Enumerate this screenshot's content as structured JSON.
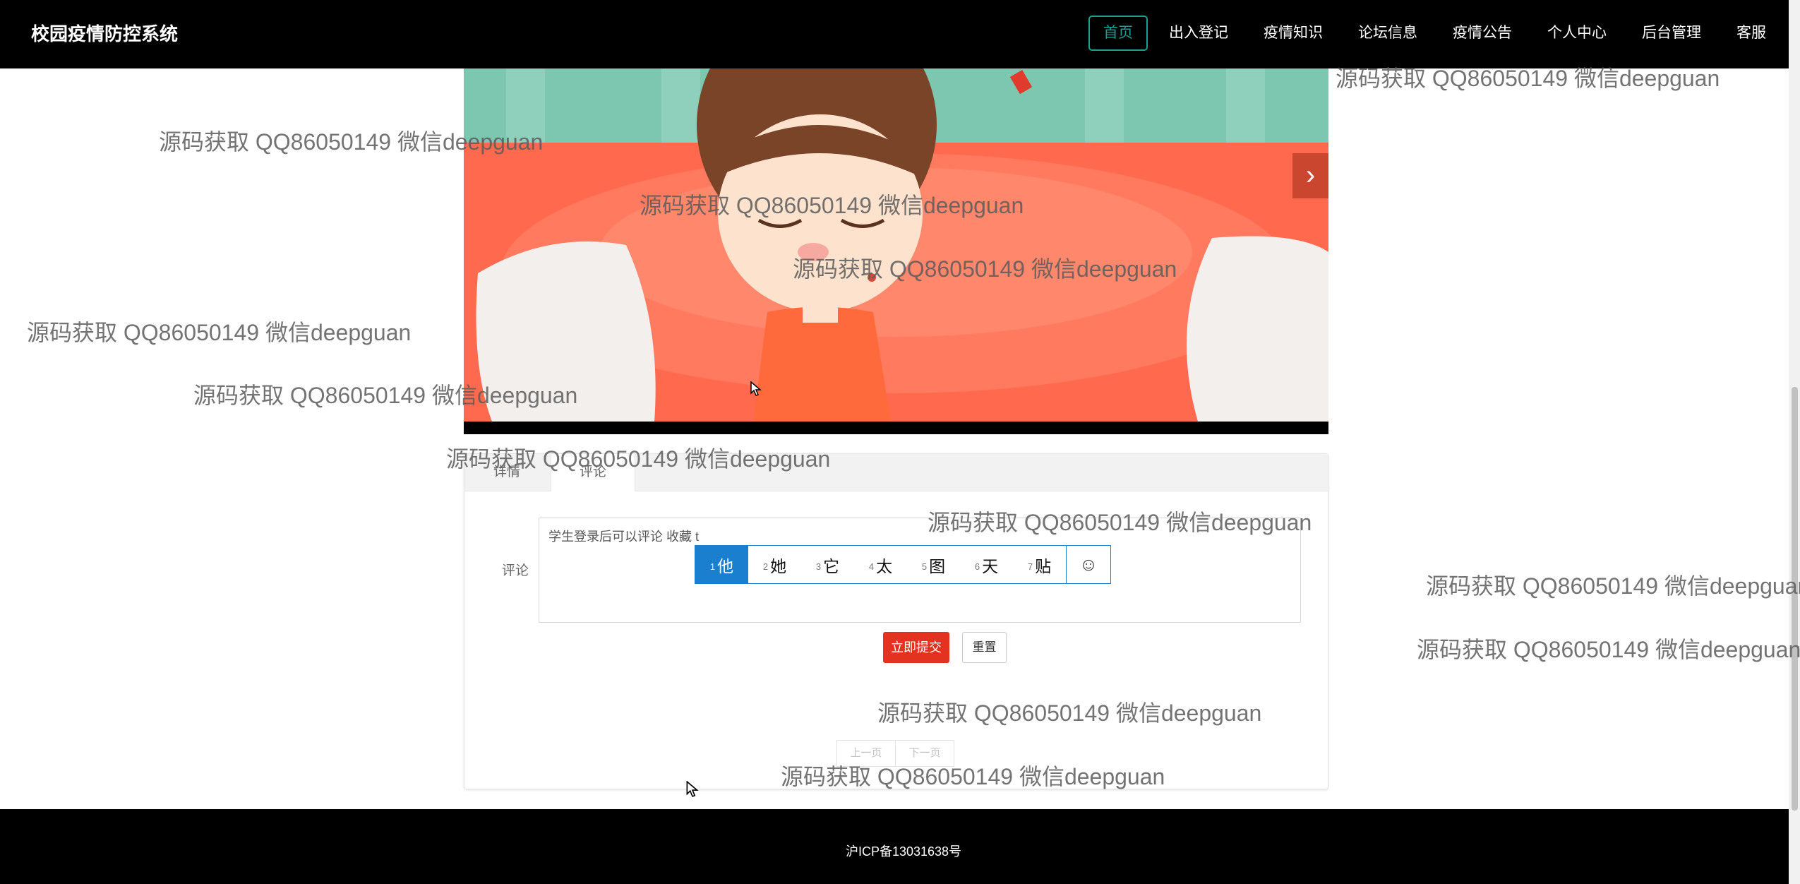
{
  "app": {
    "title": "校园疫情防控系统"
  },
  "nav": {
    "items": [
      {
        "label": "首页",
        "active": true
      },
      {
        "label": "出入登记"
      },
      {
        "label": "疫情知识"
      },
      {
        "label": "论坛信息"
      },
      {
        "label": "疫情公告"
      },
      {
        "label": "个人中心"
      },
      {
        "label": "后台管理"
      },
      {
        "label": "客服"
      }
    ]
  },
  "banner": {
    "next_icon": "chevron-right-icon",
    "next_symbol": "›"
  },
  "tabs": [
    {
      "label": "详情"
    },
    {
      "label": "评论",
      "active": true
    }
  ],
  "comment": {
    "label": "评论",
    "text": "学生登录后可以评论  收藏  t",
    "submit_label": "立即提交",
    "reset_label": "重置"
  },
  "ime": {
    "candidates": [
      {
        "n": "1",
        "text": "他",
        "selected": true
      },
      {
        "n": "2",
        "text": "她"
      },
      {
        "n": "3",
        "text": "它"
      },
      {
        "n": "4",
        "text": "太"
      },
      {
        "n": "5",
        "text": "图"
      },
      {
        "n": "6",
        "text": "天"
      },
      {
        "n": "7",
        "text": "贴"
      }
    ],
    "emoji_symbol": "☺"
  },
  "pager": {
    "prev_label": "上一页",
    "next_label": "下一页"
  },
  "footer": {
    "text": "沪ICP备13031638号"
  },
  "watermark": {
    "text": "源码获取 QQ86050149 微信deepguan"
  },
  "colors": {
    "accent": "#1aa094",
    "danger": "#e3321f",
    "ime_blue": "#1b7fd0"
  }
}
